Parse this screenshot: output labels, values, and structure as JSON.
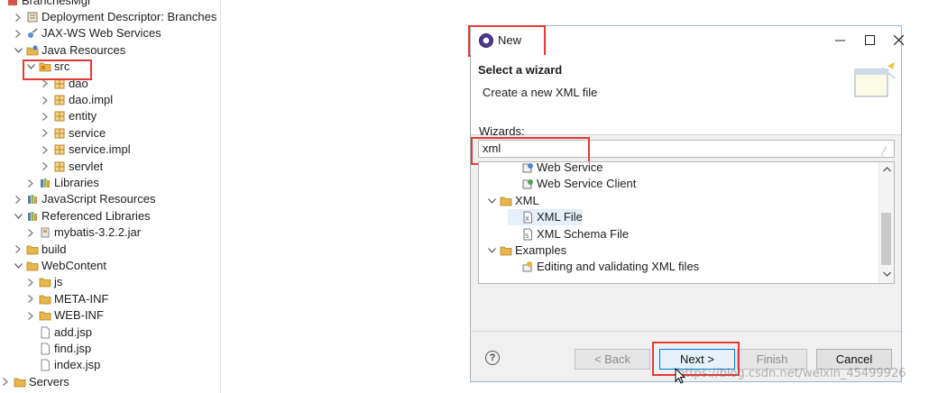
{
  "explorer": {
    "project": "BranchesMgr",
    "items": [
      {
        "label": "Deployment Descriptor: Branches",
        "icon": "descriptor-icon",
        "twisty": "collapsed"
      },
      {
        "label": "JAX-WS Web Services",
        "icon": "webservice-icon",
        "twisty": "collapsed"
      },
      {
        "label": "Java Resources",
        "icon": "java-resources-icon",
        "twisty": "expanded"
      },
      {
        "label": "src",
        "icon": "source-folder-icon",
        "twisty": "expanded"
      },
      {
        "label": "dao",
        "icon": "package-icon",
        "twisty": "collapsed"
      },
      {
        "label": "dao.impl",
        "icon": "package-icon",
        "twisty": "collapsed"
      },
      {
        "label": "entity",
        "icon": "package-icon",
        "twisty": "collapsed"
      },
      {
        "label": "service",
        "icon": "package-icon",
        "twisty": "collapsed"
      },
      {
        "label": "service.impl",
        "icon": "package-icon",
        "twisty": "collapsed"
      },
      {
        "label": "servlet",
        "icon": "package-icon",
        "twisty": "collapsed"
      },
      {
        "label": "Libraries",
        "icon": "library-icon",
        "twisty": "collapsed"
      },
      {
        "label": "JavaScript Resources",
        "icon": "js-resources-icon",
        "twisty": "collapsed"
      },
      {
        "label": "Referenced Libraries",
        "icon": "library-icon",
        "twisty": "expanded"
      },
      {
        "label": "mybatis-3.2.2.jar",
        "icon": "jar-icon",
        "twisty": "collapsed"
      },
      {
        "label": "build",
        "icon": "folder-icon",
        "twisty": "collapsed"
      },
      {
        "label": "WebContent",
        "icon": "folder-icon",
        "twisty": "expanded"
      },
      {
        "label": "js",
        "icon": "folder-icon",
        "twisty": "collapsed"
      },
      {
        "label": "META-INF",
        "icon": "folder-icon",
        "twisty": "collapsed"
      },
      {
        "label": "WEB-INF",
        "icon": "folder-icon",
        "twisty": "collapsed"
      },
      {
        "label": "add.jsp",
        "icon": "file-icon",
        "twisty": "none"
      },
      {
        "label": "find.jsp",
        "icon": "file-icon",
        "twisty": "none"
      },
      {
        "label": "index.jsp",
        "icon": "file-icon",
        "twisty": "none"
      },
      {
        "label": "Servers",
        "icon": "folder-icon",
        "twisty": "collapsed"
      }
    ]
  },
  "dialog": {
    "title": "New",
    "heading": "Select a wizard",
    "description": "Create a new XML file",
    "wizards_label": "Wizards:",
    "filter_value": "xml",
    "wizards": [
      {
        "label": "Web Service",
        "icon": "web-service-icon",
        "twisty": "none"
      },
      {
        "label": "Web Service Client",
        "icon": "web-service-client-icon",
        "twisty": "none"
      },
      {
        "label": "XML",
        "icon": "folder-icon",
        "twisty": "expanded"
      },
      {
        "label": "XML File",
        "icon": "xml-file-icon",
        "twisty": "none",
        "selected": true
      },
      {
        "label": "XML Schema File",
        "icon": "xml-schema-icon",
        "twisty": "none"
      },
      {
        "label": "Examples",
        "icon": "folder-icon",
        "twisty": "expanded"
      },
      {
        "label": "Editing and validating XML files",
        "icon": "example-icon",
        "twisty": "none"
      }
    ],
    "buttons": {
      "back": "< Back",
      "next": "Next >",
      "finish": "Finish",
      "cancel": "Cancel"
    }
  },
  "watermark": "https://blog.csdn.net/weixin_45499926",
  "colors": {
    "highlight": "#e53935",
    "selection": "#e5f0fb",
    "folder": "#e8b64a",
    "package": "#b8862b"
  }
}
